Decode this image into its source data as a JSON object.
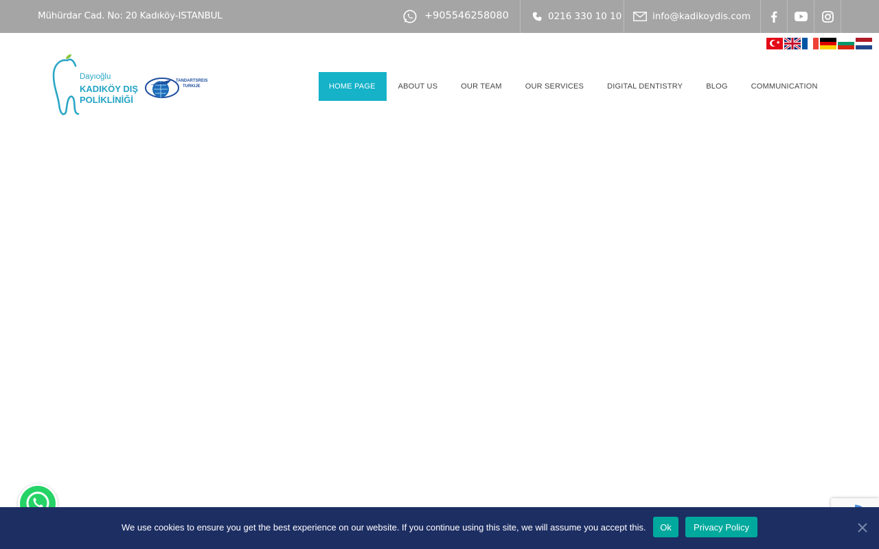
{
  "topbar": {
    "address": "Mühürdar Cad. No: 20 Kadıköy-ISTANBUL",
    "whatsapp": "+905546258080",
    "phone": "0216 330 10 10",
    "email": "info@kadikoydis.com",
    "social_icons": [
      "facebook-icon",
      "youtube-icon",
      "instagram-icon"
    ]
  },
  "languages": [
    "tr",
    "en",
    "fr",
    "de",
    "bg",
    "nl"
  ],
  "logo": {
    "line1": "Dayıoğlu",
    "line2": "KADIKÖY DIŞ",
    "line3": "POLİKLİNİĞİ",
    "partner_line1": "TANDARTSREIS",
    "partner_line2": "TURKIJE"
  },
  "nav": {
    "items": [
      {
        "label": "HOME PAGE",
        "active": true
      },
      {
        "label": "ABOUT US"
      },
      {
        "label": "OUR TEAM"
      },
      {
        "label": "OUR SERVICES"
      },
      {
        "label": "DIGITAL DENTISTRY"
      },
      {
        "label": "BLOG"
      },
      {
        "label": "COMMUNICATION"
      }
    ]
  },
  "cookie": {
    "message": "We use cookies to ensure you get the best experience on our website. If you continue using this site, we will assume you accept this.",
    "ok_label": "Ok",
    "privacy_label": "Privacy Policy"
  },
  "colors": {
    "topbar": "#a5a5a5",
    "accent": "#15b2c8",
    "cookie_bg": "#1d2e63",
    "cookie_button": "#00a99d",
    "whatsapp": "#25d366"
  }
}
